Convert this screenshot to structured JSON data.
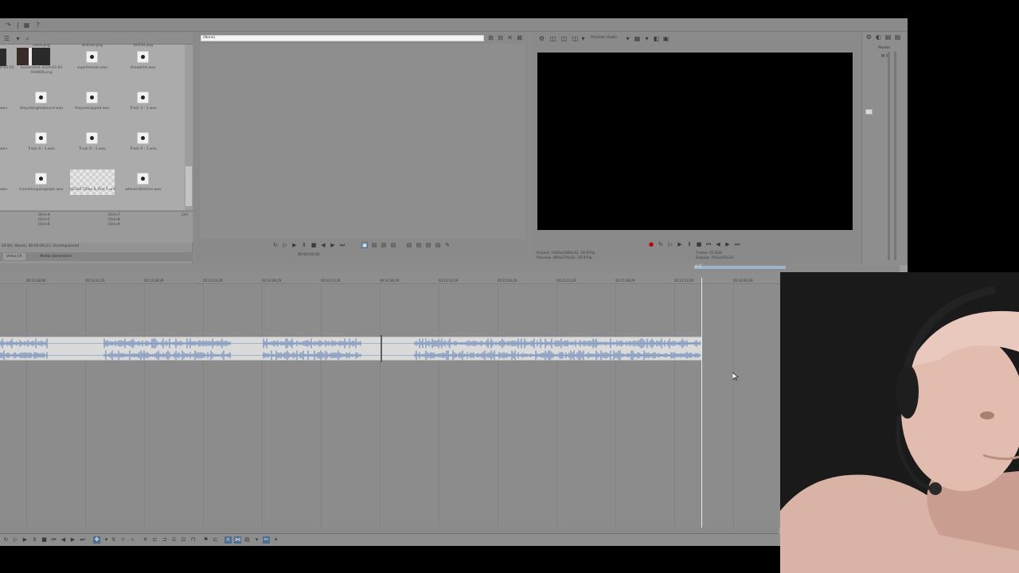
{
  "media_explorer": {
    "items": [
      {
        "name": "outro.png",
        "kind": "image"
      },
      {
        "name": "bn4rad.png",
        "kind": "image"
      },
      {
        "name": "bn154.png",
        "kind": "image"
      },
      {
        "name": "Screenshot 2026-03-03 004808.png",
        "kind": "image"
      },
      {
        "name": "superheroes.wav",
        "kind": "audio"
      },
      {
        "name": "theabilist.wav",
        "kind": "audio"
      },
      {
        "name": "theyretinglesbound.wav",
        "kind": "audio"
      },
      {
        "name": "theyvetrapped.wav",
        "kind": "audio"
      },
      {
        "name": "Track 3 - 1.wav",
        "kind": "audio"
      },
      {
        "name": "Track 4 - 1.wav",
        "kind": "audio"
      },
      {
        "name": "Track 6 - 1.wav",
        "kind": "audio"
      },
      {
        "name": "Track 9 - 1.wav",
        "kind": "audio"
      },
      {
        "name": "transitionparagraph.wav",
        "kind": "audio"
      },
      {
        "name": "VEGAS Titles & Text 1 unt",
        "kind": "title"
      },
      {
        "name": "whereisthetime.wav",
        "kind": "audio"
      }
    ],
    "edge_labels": [
      "(v)",
      "0-03-03",
      "wav",
      "wav",
      "wav"
    ],
    "shortcuts": [
      "Ctrl+4",
      "Ctrl+5",
      "Ctrl+6",
      "Ctrl+7",
      "Ctrl+8",
      "Ctrl+9",
      "Ctrl"
    ],
    "status_text": "16 Bit, Stereo, 00:00:00;23, Uncompressed",
    "tabs": [
      "Video FX",
      "Media Generators"
    ]
  },
  "trimmer": {
    "source_select": "(None)",
    "timecode": "00:00:00;00"
  },
  "preview": {
    "quality_label": "Preview (Auto)",
    "project": "Project: 1920x1080x32, 29.970p",
    "preview_res": "Preview: 480x270x32, 29.970p",
    "frame": "Frame: 25,836",
    "display": "Display: 791x445x32"
  },
  "master": {
    "label": "Master",
    "ms": "M  S"
  },
  "timeline": {
    "ruler_ticks": [
      "00:13:08;00",
      "00:13:23;29",
      "00:13:38;29",
      "00:13:53;29",
      "00:14:08;29",
      "00:14:23;29",
      "00:14:38;29",
      "00:14:53;29",
      "00:15:08;29",
      "00:15:23;29",
      "00:15:38;29",
      "00:15:53;29",
      "00:16:08;29",
      "00:16:23;29",
      "00:16:38;29"
    ],
    "loop_label": "4:11"
  },
  "colors": {
    "accent": "#4d6e8f",
    "waveform": "#6d8bb8",
    "clip_bg": "#dadada",
    "app_bg": "#8c8c8c"
  },
  "icons": {
    "top": [
      "undo-icon",
      "redo-icon",
      "settings-icon",
      "help-icon"
    ],
    "trimmer_controls": [
      "loop-icon",
      "play-from-start-icon",
      "play-icon",
      "pause-icon",
      "stop-icon",
      "prev-frame-icon",
      "next-frame-icon"
    ],
    "bottom_toolbar": [
      "loop-icon",
      "play-from-start-icon",
      "play-icon",
      "pause-icon",
      "stop-icon",
      "prev-marker-icon",
      "next-marker-icon",
      "normal-edit-tool-icon",
      "envelope-tool-icon",
      "zoom-tool-icon",
      "snap-icon",
      "auto-ripple-icon"
    ]
  }
}
